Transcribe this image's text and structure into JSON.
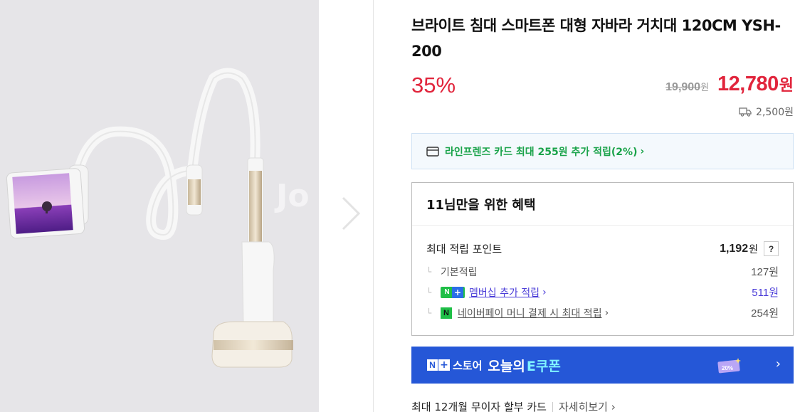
{
  "product": {
    "title": "브라이트 침대 스마트폰 대형 자바라 거치대 120CM YSH-200",
    "discount": "35%",
    "original_price": "19,900",
    "original_unit": "원",
    "sale_price": "12,780",
    "sale_unit": "원",
    "shipping_fee": "2,500원"
  },
  "gallery": {
    "watermark": "Jo",
    "next_icon": "chevron-right-icon"
  },
  "card_promo": {
    "text": "라인프렌즈 카드 최대 255원 추가 적립(2%)",
    "icon": "credit-card-icon"
  },
  "benefit": {
    "heading": "11님만을 위한 혜택",
    "max_point_label": "최대 적립 포인트",
    "max_point_value": "1,192",
    "max_point_unit": "원",
    "help_label": "?",
    "rows": [
      {
        "label": "기본적립",
        "value": "127원"
      },
      {
        "label": "멤버십 추가 적립",
        "value": "511원"
      },
      {
        "label": "네이버페이 머니 결제 시 최대 적립",
        "value": "254원"
      }
    ],
    "tree_glyph": "└",
    "nplus_n": "N",
    "nplus_plus": "+",
    "npay_glyph": "N"
  },
  "coupon": {
    "logo_n": "N",
    "logo_plus": "+",
    "store": "스토어",
    "today": "오늘의",
    "ecoupon": "E쿠폰",
    "badge": "20%",
    "bg_color": "#2557d7"
  },
  "installment": {
    "text": "최대 12개월 무이자 할부 카드",
    "more": "자세히보기 ›"
  },
  "colors": {
    "accent_red": "#e1253c",
    "naver_green": "#1aa34a",
    "member_blue": "#4a3cd8"
  }
}
